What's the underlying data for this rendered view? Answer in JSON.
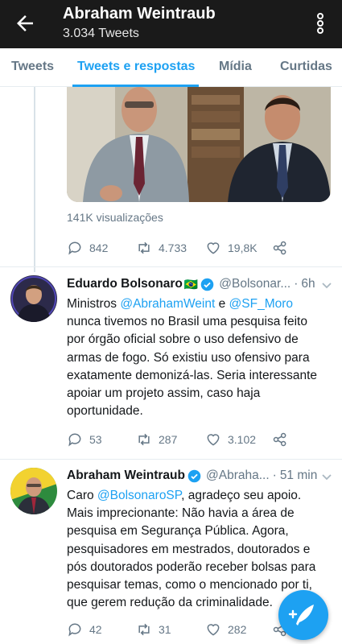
{
  "header": {
    "title": "Abraham Weintraub",
    "subtitle": "3.034 Tweets"
  },
  "tabs": [
    {
      "label": "Tweets"
    },
    {
      "label": "Tweets e respostas"
    },
    {
      "label": "Mídia"
    },
    {
      "label": "Curtidas"
    }
  ],
  "tweet1": {
    "views": "141K visualizações",
    "replies": "842",
    "retweets": "4.733",
    "likes": "19,8K"
  },
  "tweet2": {
    "name": "Eduardo Bolsonaro",
    "flag_emoji": "🇧🇷",
    "handle": "@Bolsonar...",
    "time": "6h",
    "sep": "·",
    "text_1": "Ministros ",
    "mention_1": "@AbrahamWeint",
    "text_2": " e ",
    "mention_2": "@SF_Moro",
    "text_3": " nunca tivemos no Brasil uma pesquisa feito por órgão oficial sobre o uso defensivo de armas de fogo. Só existiu uso ofensivo para exatamente demonizá-las. Seria interessante apoiar um projeto assim, caso haja oportunidade.",
    "replies": "53",
    "retweets": "287",
    "likes": "3.102"
  },
  "tweet3": {
    "name": "Abraham Weintraub",
    "handle": "@Abraha...",
    "time": "51 min",
    "sep": "·",
    "text_1": "Caro ",
    "mention_1": "@BolsonaroSP",
    "text_2": ", agradeço seu apoio. Mais imprecionante: Não havia a área de pesquisa em Segurança Pública. Agora, pesquisadores em mestrados, doutorados e pós doutorados poderão receber bolsas para pesquisar temas, como o mencionado por ti, que gerem redução da criminalidade.",
    "replies": "42",
    "retweets": "31",
    "likes": "282"
  },
  "icons": {
    "back": "arrow-left-icon",
    "more": "more-vertical-icon",
    "reply": "reply-icon",
    "retweet": "retweet-icon",
    "like": "heart-icon",
    "share": "share-icon",
    "verified": "verified-badge-icon",
    "compose": "compose-tweet-icon"
  },
  "colors": {
    "accent": "#1da1f2",
    "header_bg": "#1a1a1a",
    "muted": "#657786"
  }
}
